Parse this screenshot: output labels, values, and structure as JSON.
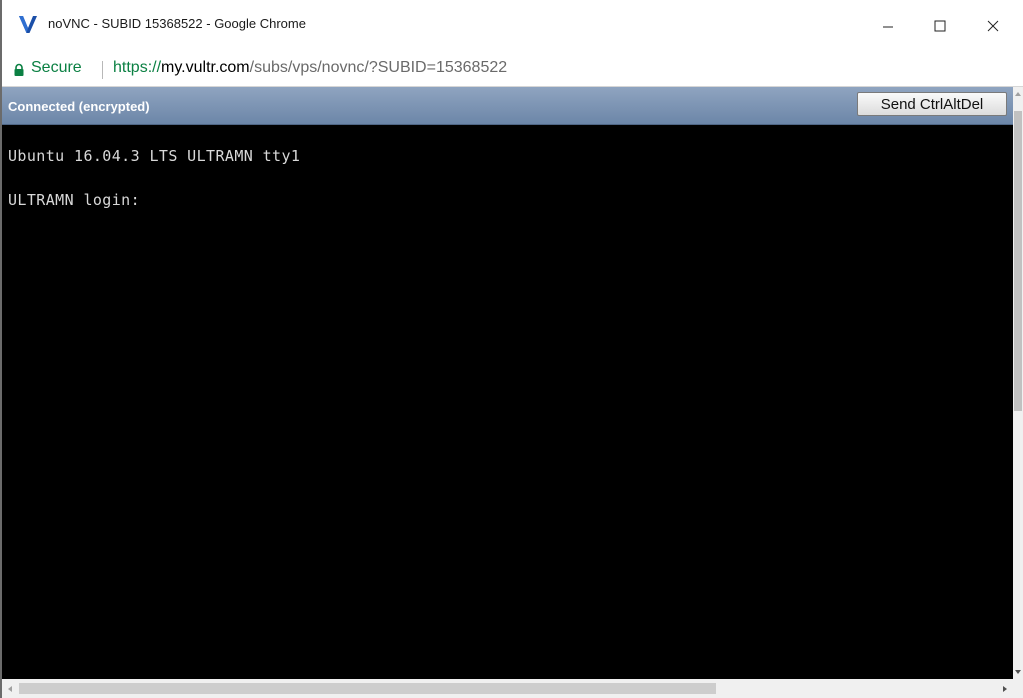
{
  "window": {
    "title": "noVNC - SUBID 15368522 - Google Chrome",
    "logo_icon": "vultr-v-logo-icon",
    "controls": {
      "minimize_icon": "minimize-icon",
      "maximize_icon": "maximize-icon",
      "close_icon": "close-icon"
    }
  },
  "addressbar": {
    "secure_label": "Secure",
    "url_scheme": "https://",
    "url_host": "my.vultr.com",
    "url_path": "/subs/vps/novnc/?SUBID=15368522",
    "lock_icon": "lock-icon"
  },
  "vnc": {
    "status": "Connected (encrypted)",
    "ctrlaltdel_label": "Send CtrlAltDel"
  },
  "terminal": {
    "lines": [
      "Ubuntu 16.04.3 LTS ULTRAMN tty1",
      "ULTRAMN login:"
    ]
  },
  "colors": {
    "secure_green": "#0b8043",
    "status_bar_blue": "#6c86a8",
    "terminal_bg": "#000000",
    "terminal_fg": "#d8d8d8",
    "vultr_logo_blue": "#1b4fa8"
  }
}
